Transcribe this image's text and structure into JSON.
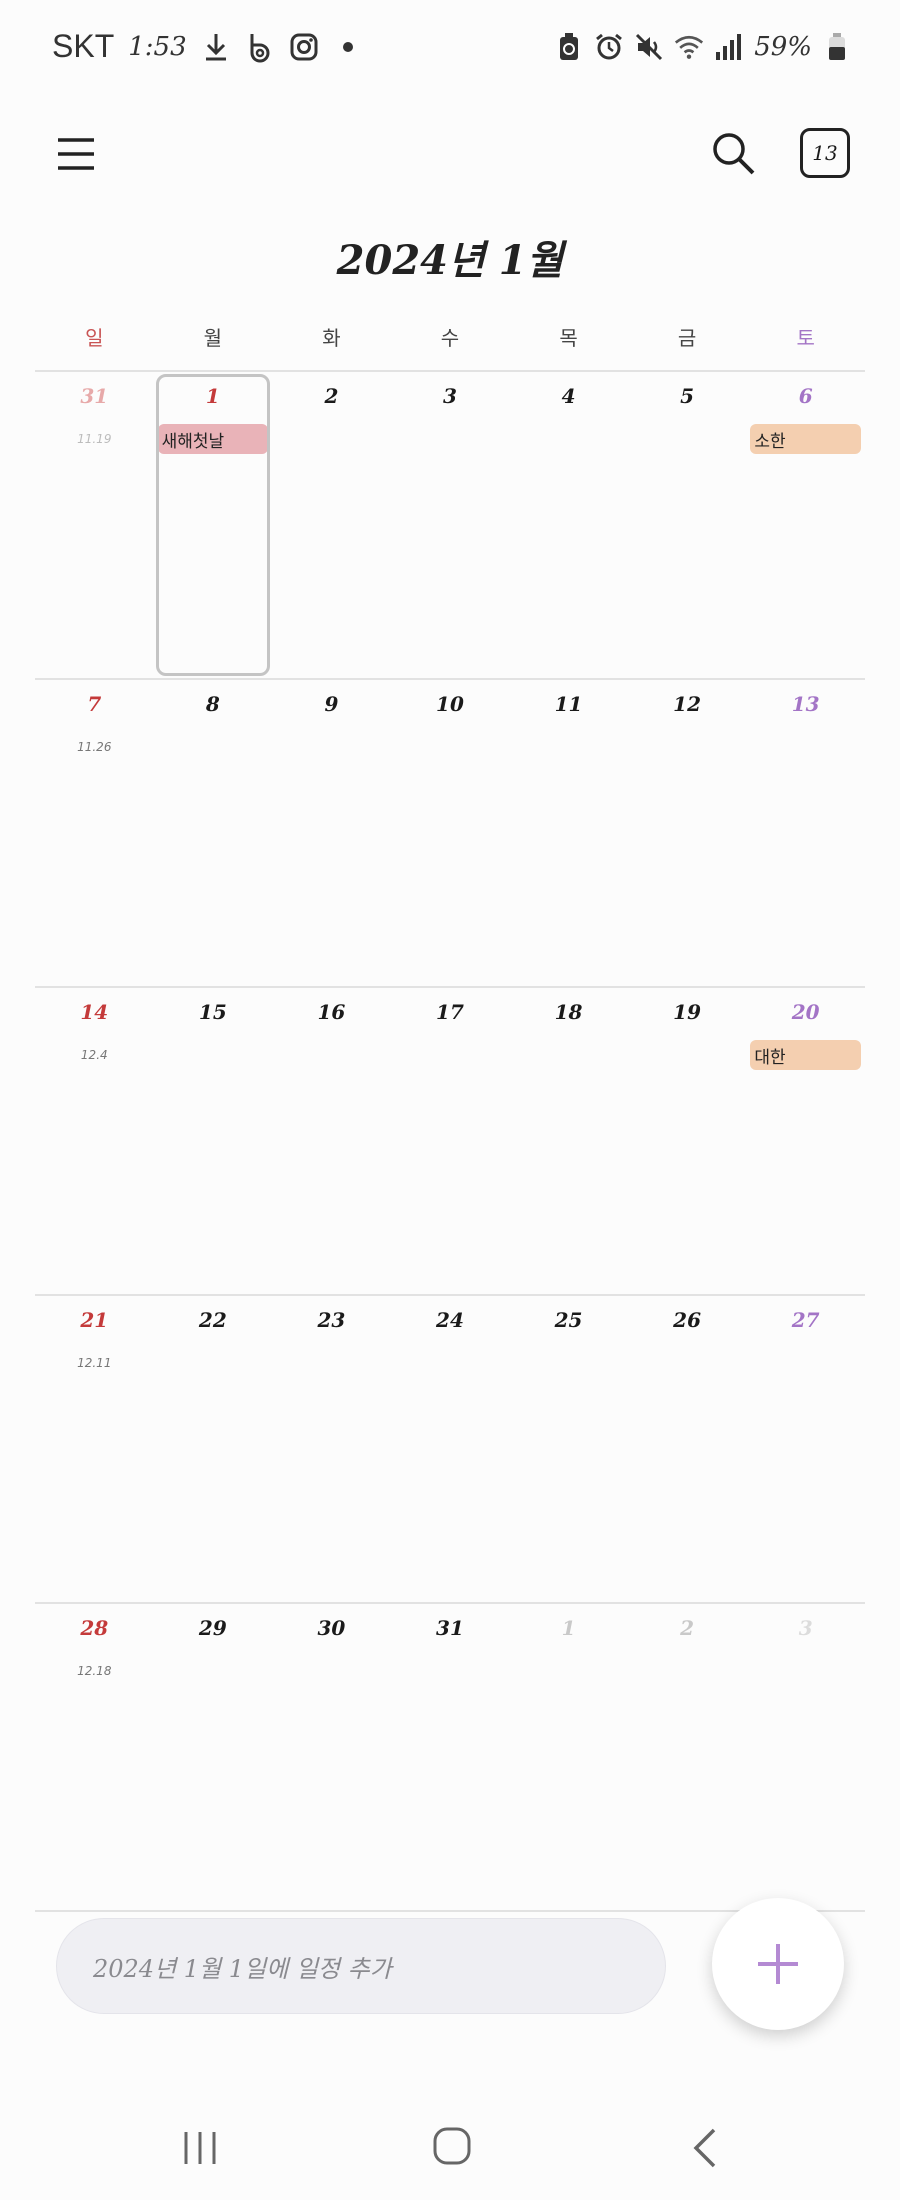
{
  "status_bar": {
    "carrier": "SKT",
    "time": "1:53",
    "battery": "59%",
    "icons": [
      "download-icon",
      "b-app-icon",
      "instagram-icon",
      "dot-icon",
      "battery-saver-icon",
      "alarm-icon",
      "mute-icon",
      "wifi-icon",
      "signal-icon",
      "battery-icon"
    ]
  },
  "header": {
    "today_badge": "13",
    "month_title": "2024년 1월"
  },
  "weekdays": [
    "일",
    "월",
    "화",
    "수",
    "목",
    "금",
    "토"
  ],
  "colors": {
    "sunday": "#c43a3a",
    "saturday": "#a374c6",
    "holiday_event": "#e9b3b8",
    "term_event": "#f4cfb0",
    "fab_plus": "#b48ad3"
  },
  "weeks": [
    [
      {
        "day": "31",
        "lunar": "11.19",
        "other": true
      },
      {
        "day": "1",
        "selected": true,
        "holiday": true,
        "event": "새해첫날",
        "event_color": "#e9b3b8"
      },
      {
        "day": "2"
      },
      {
        "day": "3"
      },
      {
        "day": "4"
      },
      {
        "day": "5"
      },
      {
        "day": "6",
        "event": "소한",
        "event_color": "#f4cfb0"
      }
    ],
    [
      {
        "day": "7",
        "lunar": "11.26"
      },
      {
        "day": "8"
      },
      {
        "day": "9"
      },
      {
        "day": "10"
      },
      {
        "day": "11"
      },
      {
        "day": "12"
      },
      {
        "day": "13"
      }
    ],
    [
      {
        "day": "14",
        "lunar": "12.4"
      },
      {
        "day": "15"
      },
      {
        "day": "16"
      },
      {
        "day": "17"
      },
      {
        "day": "18"
      },
      {
        "day": "19"
      },
      {
        "day": "20",
        "event": "대한",
        "event_color": "#f4cfb0"
      }
    ],
    [
      {
        "day": "21",
        "lunar": "12.11"
      },
      {
        "day": "22"
      },
      {
        "day": "23"
      },
      {
        "day": "24"
      },
      {
        "day": "25"
      },
      {
        "day": "26"
      },
      {
        "day": "27"
      }
    ],
    [
      {
        "day": "28",
        "lunar": "12.18"
      },
      {
        "day": "29"
      },
      {
        "day": "30"
      },
      {
        "day": "31"
      },
      {
        "day": "1",
        "other": true
      },
      {
        "day": "2",
        "other": true
      },
      {
        "day": "3",
        "other": true
      }
    ]
  ],
  "add_event": {
    "placeholder": "2024년 1월 1일에 일정 추가"
  }
}
